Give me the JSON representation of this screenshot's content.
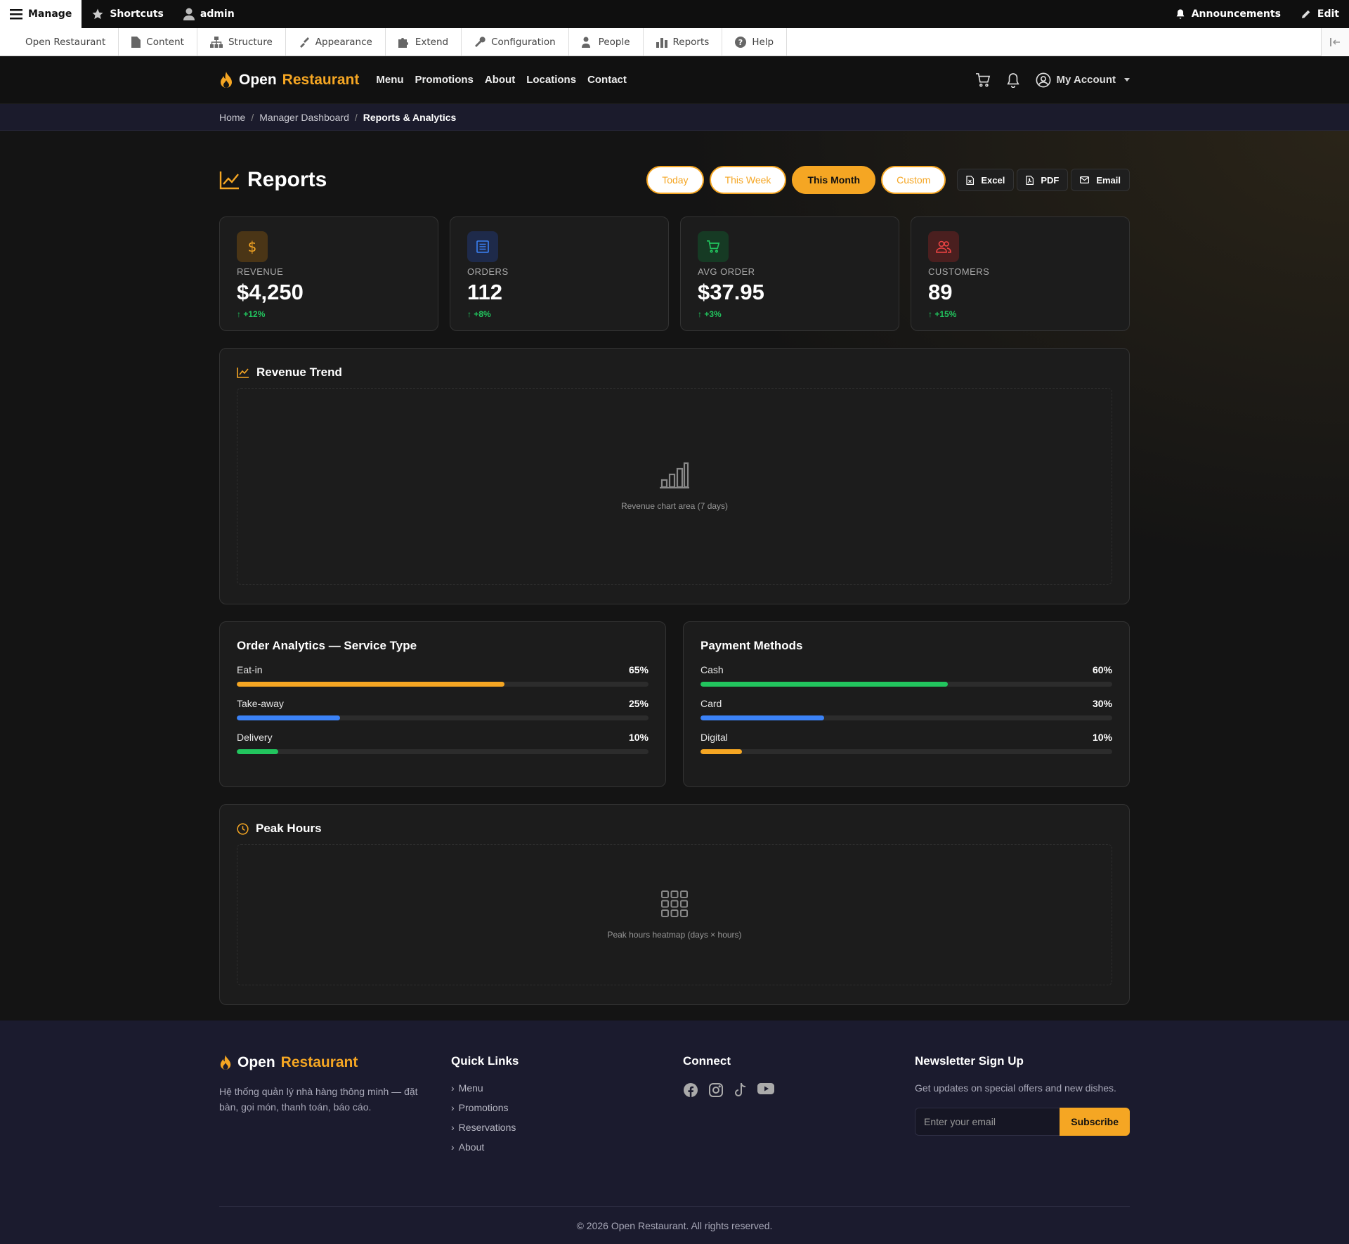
{
  "admin_bar": {
    "manage": "Manage",
    "shortcuts": "Shortcuts",
    "user": "admin",
    "announcements": "Announcements",
    "edit": "Edit"
  },
  "admin_tray": {
    "items": [
      "Open Restaurant",
      "Content",
      "Structure",
      "Appearance",
      "Extend",
      "Configuration",
      "People",
      "Reports",
      "Help"
    ]
  },
  "header": {
    "brand_first": "Open",
    "brand_second": "Restaurant",
    "nav": [
      "Menu",
      "Promotions",
      "About",
      "Locations",
      "Contact"
    ],
    "account": "My Account"
  },
  "breadcrumb": [
    "Home",
    "Manager Dashboard",
    "Reports & Analytics"
  ],
  "page": {
    "title": "Reports",
    "ranges": [
      "Today",
      "This Week",
      "This Month",
      "Custom"
    ],
    "active_range": "This Month",
    "exports": [
      "Excel",
      "PDF",
      "Email"
    ]
  },
  "kpis": [
    {
      "label": "REVENUE",
      "value": "$4,250",
      "change": "↑ +12%",
      "icon": "dollar-icon",
      "color": "#f5a623"
    },
    {
      "label": "ORDERS",
      "value": "112",
      "change": "↑ +8%",
      "icon": "receipt-icon",
      "color": "#3b82f6"
    },
    {
      "label": "AVG ORDER",
      "value": "$37.95",
      "change": "↑ +3%",
      "icon": "cart-icon",
      "color": "#22c55e"
    },
    {
      "label": "CUSTOMERS",
      "value": "89",
      "change": "↑ +15%",
      "icon": "users-icon",
      "color": "#ef4444"
    }
  ],
  "revenue_trend": {
    "title": "Revenue Trend",
    "placeholder": "Revenue chart area (7 days)"
  },
  "order_analytics": {
    "title": "Order Analytics — Service Type",
    "rows": [
      {
        "label": "Eat-in",
        "pct": "65%",
        "value": 65,
        "color": "#f5a623"
      },
      {
        "label": "Take-away",
        "pct": "25%",
        "value": 25,
        "color": "#3b82f6"
      },
      {
        "label": "Delivery",
        "pct": "10%",
        "value": 10,
        "color": "#22c55e"
      }
    ]
  },
  "payment_methods": {
    "title": "Payment Methods",
    "rows": [
      {
        "label": "Cash",
        "pct": "60%",
        "value": 60,
        "color": "#22c55e"
      },
      {
        "label": "Card",
        "pct": "30%",
        "value": 30,
        "color": "#3b82f6"
      },
      {
        "label": "Digital",
        "pct": "10%",
        "value": 10,
        "color": "#f5a623"
      }
    ]
  },
  "peak_hours": {
    "title": "Peak Hours",
    "placeholder": "Peak hours heatmap (days × hours)"
  },
  "footer": {
    "brand_first": "Open",
    "brand_second": "Restaurant",
    "description": "Hệ thống quản lý nhà hàng thông minh — đặt bàn, gọi món, thanh toán, báo cáo.",
    "quick_links_title": "Quick Links",
    "quick_links": [
      "Menu",
      "Promotions",
      "Reservations",
      "About"
    ],
    "connect_title": "Connect",
    "newsletter_title": "Newsletter Sign Up",
    "newsletter_text": "Get updates on special offers and new dishes.",
    "email_placeholder": "Enter your email",
    "subscribe": "Subscribe",
    "copyright": "© 2026 Open Restaurant. All rights reserved."
  },
  "colors": {
    "accent": "#f5a623",
    "success": "#22c55e",
    "info": "#3b82f6",
    "danger": "#ef4444"
  }
}
